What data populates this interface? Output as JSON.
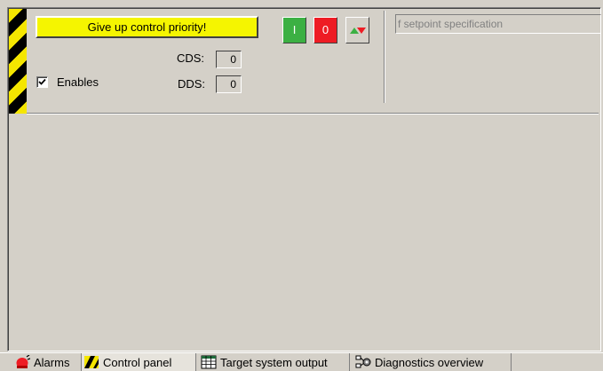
{
  "control_panel": {
    "give_up_button": "Give up control priority!",
    "cds_label": "CDS:",
    "cds_value": "0",
    "dds_label": "DDS:",
    "dds_value": "0",
    "enables_label": "Enables",
    "enables_checked": true,
    "on_button": "I",
    "off_button": "0",
    "reverse_icon": "up-down-arrows-icon",
    "setpoint_placeholder": "f setpoint specification"
  },
  "tabs": [
    {
      "label": "Alarms",
      "icon": "alarm-bell-icon"
    },
    {
      "label": "Control panel",
      "icon": "hazard-stripes-icon"
    },
    {
      "label": "Target system output",
      "icon": "grid-table-icon"
    },
    {
      "label": "Diagnostics overview",
      "icon": "diagnostics-network-icon"
    }
  ],
  "colors": {
    "background": "#d4d0c8",
    "give_up_yellow": "#f5f500",
    "on_green": "#3cb043",
    "off_red": "#ee1c24"
  }
}
